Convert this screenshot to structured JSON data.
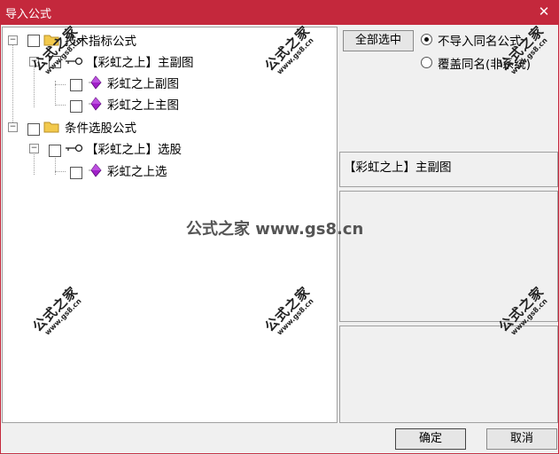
{
  "window": {
    "title": "导入公式",
    "close_glyph": "✕"
  },
  "tree": [
    {
      "label": "技术指标公式",
      "level": 0,
      "icon": "folder-icon"
    },
    {
      "label": "【彩虹之上】主副图",
      "level": 1,
      "icon": "key-icon"
    },
    {
      "label": "彩虹之上副图",
      "level": 2,
      "icon": "formula-icon"
    },
    {
      "label": "彩虹之上主图",
      "level": 2,
      "icon": "formula-icon"
    },
    {
      "label": "条件选股公式",
      "level": 0,
      "icon": "folder-icon"
    },
    {
      "label": "【彩虹之上】选股",
      "level": 1,
      "icon": "key-icon"
    },
    {
      "label": "彩虹之上选",
      "level": 2,
      "icon": "formula-icon"
    }
  ],
  "options": {
    "select_all_label": "全部选中",
    "radio_skip_label": "不导入同名公式",
    "radio_overwrite_label": "覆盖同名(非系统)",
    "selected": "skip"
  },
  "info": {
    "selected_name": "【彩虹之上】主副图"
  },
  "footer": {
    "ok_label": "确定",
    "cancel_label": "取消"
  },
  "watermark": {
    "brand": "公式之家",
    "url": "www.gs8.cn",
    "center": "公式之家 www.gs8.cn"
  },
  "colors": {
    "titlebar": "#c4283c",
    "folder": "#f2c94c",
    "gem": "#a020c8"
  }
}
